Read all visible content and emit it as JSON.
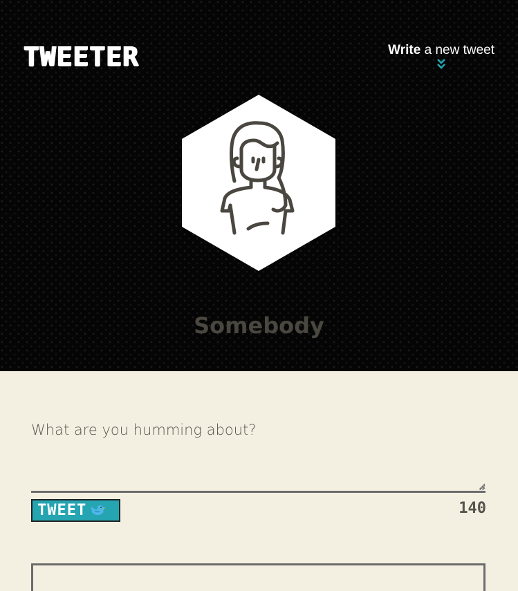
{
  "header": {
    "logo": "TWEETER",
    "write_link": {
      "strong": "Write",
      "rest": " a new tweet"
    },
    "user_name": "Somebody"
  },
  "composer": {
    "placeholder": "What are you humming about?",
    "tweet_button_label": "TWEET",
    "char_counter": "140"
  },
  "colors": {
    "accent": "#25a4b2",
    "header_bg": "#050505",
    "page_bg": "#f4f0e1",
    "text_dark": "#4a4740"
  },
  "icons": {
    "write_chevron": "double-chevron-down-icon",
    "avatar": "avatar-woman-icon",
    "tweet_button": "bird-icon"
  }
}
